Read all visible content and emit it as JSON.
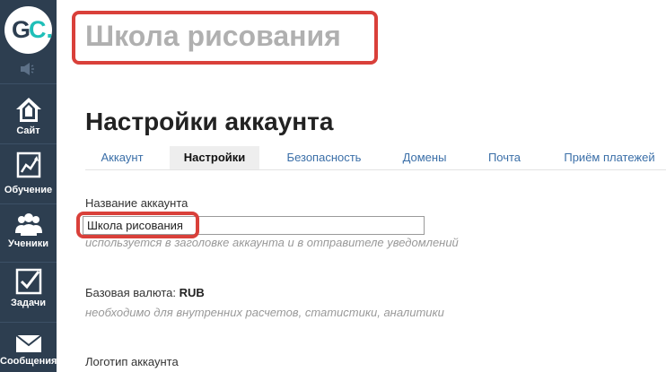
{
  "brand": {
    "logo_g": "G",
    "logo_c": "C."
  },
  "sidebar": {
    "items": [
      {
        "label": "Сайт",
        "icon": "house-icon"
      },
      {
        "label": "Обучение",
        "icon": "chart-icon"
      },
      {
        "label": "Ученики",
        "icon": "users-icon"
      },
      {
        "label": "Задачи",
        "icon": "checkbox-icon"
      },
      {
        "label": "Сообщения",
        "icon": "envelope-icon"
      }
    ]
  },
  "header": {
    "school_name": "Школа рисования"
  },
  "page": {
    "title": "Настройки аккаунта"
  },
  "tabs": [
    {
      "label": "Аккаунт",
      "active": false
    },
    {
      "label": "Настройки",
      "active": true
    },
    {
      "label": "Безопасность",
      "active": false
    },
    {
      "label": "Домены",
      "active": false
    },
    {
      "label": "Почта",
      "active": false
    },
    {
      "label": "Приём платежей",
      "active": false
    }
  ],
  "form": {
    "account_name": {
      "label": "Название аккаунта",
      "value": "Школа рисования",
      "hint": "используется в заголовке аккаунта и в отправителе уведомлений"
    },
    "currency": {
      "label": "Базовая валюта:",
      "value": "RUB",
      "hint": "необходимо для внутренних расчетов, статистики, аналитики"
    },
    "logo": {
      "label": "Логотип аккаунта"
    }
  },
  "colors": {
    "sidebar_bg": "#2d3e50",
    "accent_teal": "#1fbfb8",
    "highlight_red": "#d9403a",
    "tab_link": "#3b6fa8"
  }
}
